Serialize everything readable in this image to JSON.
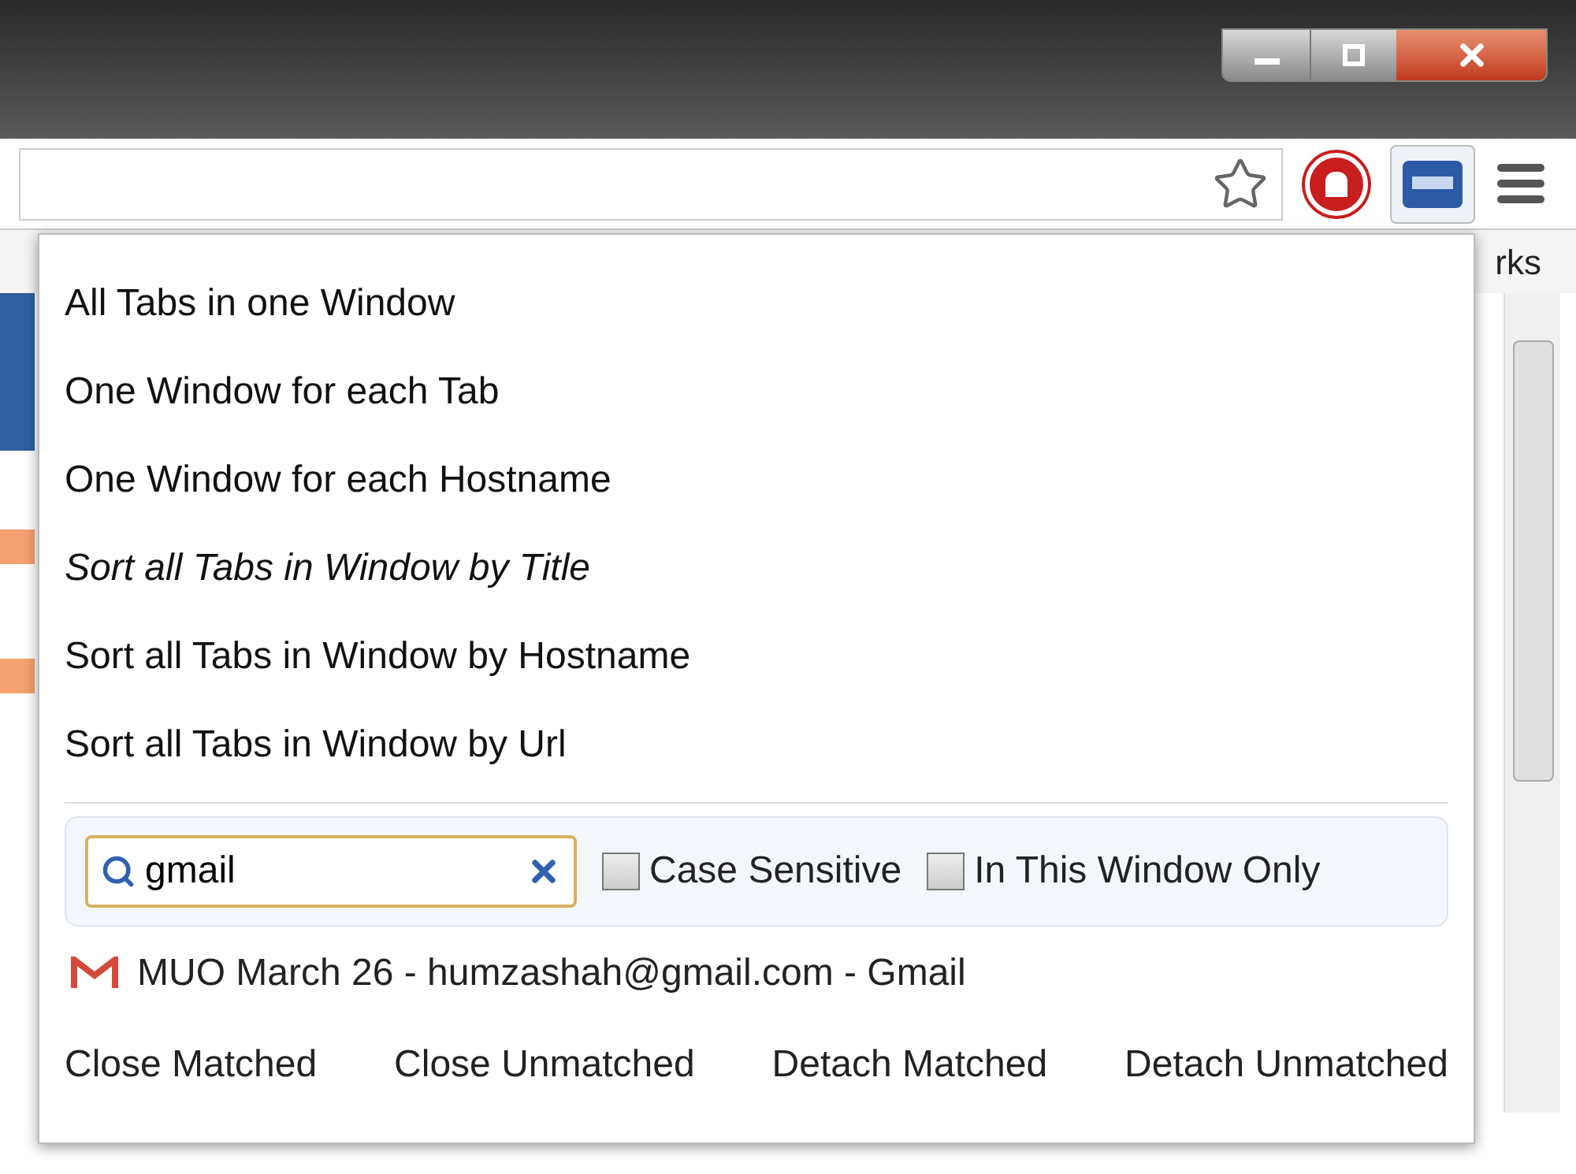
{
  "bookmarks_bar": {
    "visible_text": "rks"
  },
  "menu": [
    {
      "label": "All Tabs in one Window",
      "hovered": false
    },
    {
      "label": "One Window for each Tab",
      "hovered": false
    },
    {
      "label": "One Window for each Hostname",
      "hovered": false
    },
    {
      "label": "Sort all Tabs in Window by Title",
      "hovered": true
    },
    {
      "label": "Sort all Tabs in Window by Hostname",
      "hovered": false
    },
    {
      "label": "Sort all Tabs in Window by Url",
      "hovered": false
    }
  ],
  "search": {
    "value": "gmail"
  },
  "options": [
    {
      "label": "Case Sensitive",
      "checked": false
    },
    {
      "label": "In This Window Only",
      "checked": false
    }
  ],
  "results": [
    {
      "title": "MUO March 26 - humzashah@gmail.com - Gmail"
    }
  ],
  "actions": [
    "Close Matched",
    "Close Unmatched",
    "Detach Matched",
    "Detach Unmatched"
  ]
}
